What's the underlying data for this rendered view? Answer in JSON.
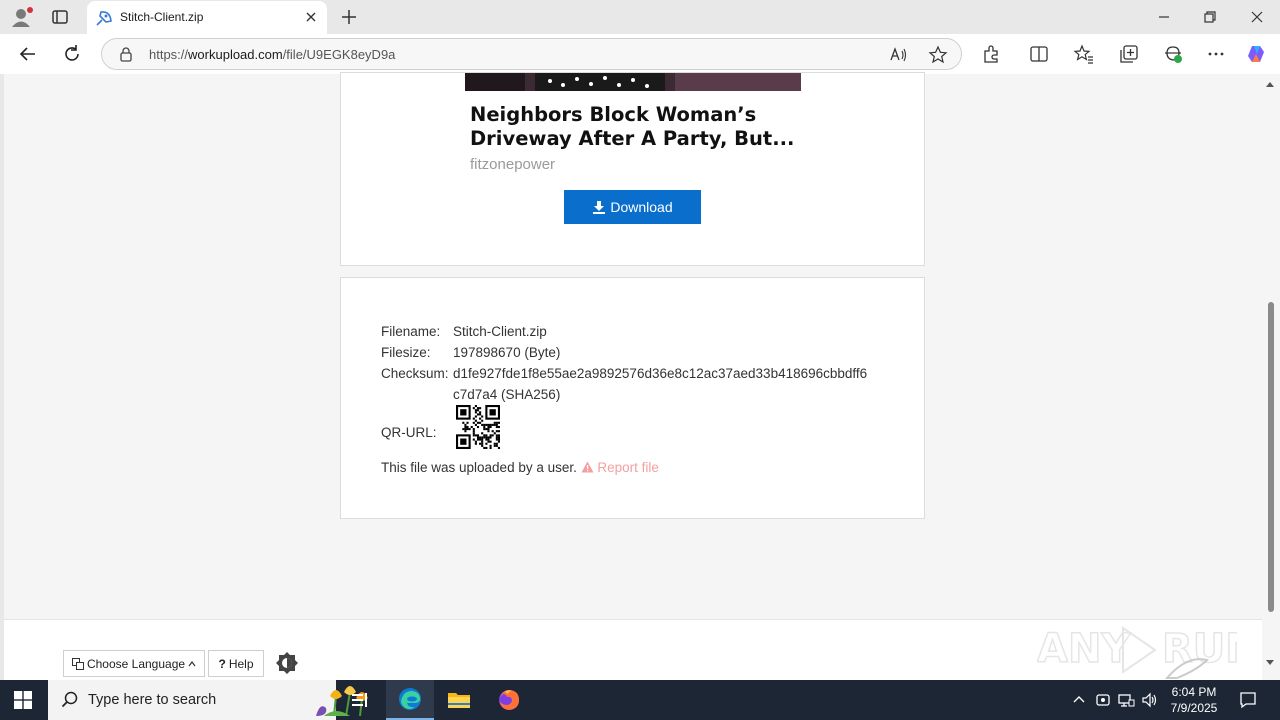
{
  "browser": {
    "tab_title": "Stitch-Client.zip",
    "url_prefix": "https://",
    "url_host": "workupload.com",
    "url_path": "/file/U9EGK8eyD9a"
  },
  "ad": {
    "headline": "Neighbors Block Woman’s Driveway After A Party, But...",
    "source": "fitzonepower"
  },
  "download_label": "Download",
  "file_info": {
    "filename_label": "Filename:",
    "filename": "Stitch-Client.zip",
    "filesize_label": "Filesize:",
    "filesize": "197898670 (Byte)",
    "checksum_label": "Checksum:",
    "checksum_line1": "d1fe927fde1f8e55ae2a9892576d36e8c12ac37aed33b418696cbbdff6",
    "checksum_line2": "c7d7a4 (SHA256)",
    "qr_label": "QR-URL:",
    "uploaded_text": "This file was uploaded by a user.",
    "report_label": "Report file"
  },
  "footer": {
    "language_label": "Choose Language",
    "help_label": "Help"
  },
  "taskbar": {
    "search_placeholder": "Type here to search",
    "time": "6:04 PM",
    "date": "7/9/2025"
  },
  "colors": {
    "download_button": "#0a6fcc",
    "report_link": "#f3a0a0",
    "taskbar": "#1c2634"
  }
}
